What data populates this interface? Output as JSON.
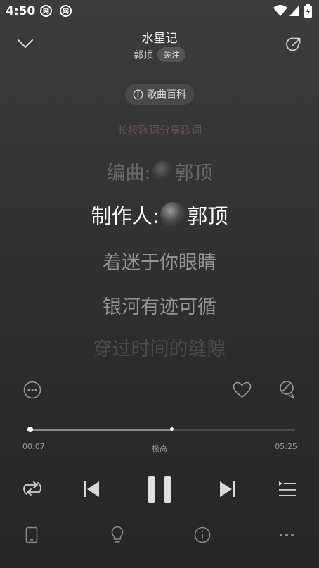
{
  "status_bar": {
    "time": "4:50",
    "app_badge": "网"
  },
  "header": {
    "title": "水星记",
    "artist": "郭顶",
    "follow_label": "关注"
  },
  "baike": {
    "label": "歌曲百科"
  },
  "lyrics": {
    "hint": "长按歌词分享歌词",
    "line0_prefix": "编曲:",
    "line0_name": "郭顶",
    "line1_prefix": "制作人:",
    "line1_name": "郭顶",
    "line2": "着迷于你眼睛",
    "line3": "银河有迹可循",
    "line4": "穿过时间的缝隙"
  },
  "player": {
    "progress": 0.012,
    "buffered": 0.54,
    "elapsed": "00:07",
    "total": "05:25",
    "quality": "极高"
  }
}
